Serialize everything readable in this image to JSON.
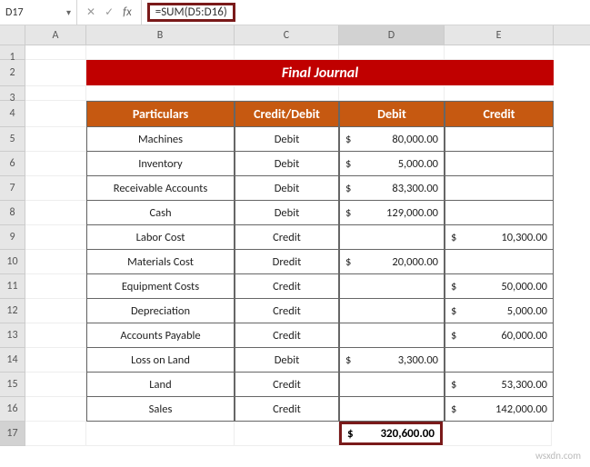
{
  "formulaBar": {
    "nameBox": "D17",
    "formula": "=SUM(D5:D16)"
  },
  "columns": [
    "A",
    "B",
    "C",
    "D",
    "E"
  ],
  "title": "Final Journal",
  "headers": {
    "particulars": "Particulars",
    "creditDebit": "Credit/Debit",
    "debit": "Debit",
    "credit": "Credit"
  },
  "rows": [
    {
      "n": "5",
      "p": "Machines",
      "cd": "Debit",
      "d": "80,000.00",
      "c": ""
    },
    {
      "n": "6",
      "p": "Inventory",
      "cd": "Debit",
      "d": "5,000.00",
      "c": ""
    },
    {
      "n": "7",
      "p": "Receivable Accounts",
      "cd": "Debit",
      "d": "83,300.00",
      "c": ""
    },
    {
      "n": "8",
      "p": "Cash",
      "cd": "Debit",
      "d": "129,000.00",
      "c": ""
    },
    {
      "n": "9",
      "p": "Labor Cost",
      "cd": "Credit",
      "d": "",
      "c": "10,300.00"
    },
    {
      "n": "10",
      "p": "Materials Cost",
      "cd": "Dredit",
      "d": "20,000.00",
      "c": ""
    },
    {
      "n": "11",
      "p": "Equipment Costs",
      "cd": "Credit",
      "d": "",
      "c": "50,000.00"
    },
    {
      "n": "12",
      "p": "Depreciation",
      "cd": "Credit",
      "d": "",
      "c": "5,000.00"
    },
    {
      "n": "13",
      "p": "Accounts Payable",
      "cd": "Credit",
      "d": "",
      "c": "60,000.00"
    },
    {
      "n": "14",
      "p": "Loss on Land",
      "cd": "Debit",
      "d": "3,300.00",
      "c": ""
    },
    {
      "n": "15",
      "p": "Land",
      "cd": "Credit",
      "d": "",
      "c": "53,300.00"
    },
    {
      "n": "16",
      "p": "Sales",
      "cd": "Credit",
      "d": "",
      "c": "142,000.00"
    }
  ],
  "total": {
    "row": "17",
    "debit": "320,600.00"
  },
  "watermark": "wsxdn.com",
  "chart_data": {
    "type": "table",
    "title": "Final Journal",
    "columns": [
      "Particulars",
      "Credit/Debit",
      "Debit",
      "Credit"
    ],
    "data": [
      [
        "Machines",
        "Debit",
        80000.0,
        null
      ],
      [
        "Inventory",
        "Debit",
        5000.0,
        null
      ],
      [
        "Receivable Accounts",
        "Debit",
        83300.0,
        null
      ],
      [
        "Cash",
        "Debit",
        129000.0,
        null
      ],
      [
        "Labor Cost",
        "Credit",
        null,
        10300.0
      ],
      [
        "Materials Cost",
        "Dredit",
        20000.0,
        null
      ],
      [
        "Equipment Costs",
        "Credit",
        null,
        50000.0
      ],
      [
        "Depreciation",
        "Credit",
        null,
        5000.0
      ],
      [
        "Accounts Payable",
        "Credit",
        null,
        60000.0
      ],
      [
        "Loss on Land",
        "Debit",
        3300.0,
        null
      ],
      [
        "Land",
        "Credit",
        null,
        53300.0
      ],
      [
        "Sales",
        "Credit",
        null,
        142000.0
      ]
    ],
    "totals": {
      "Debit": 320600.0
    }
  }
}
